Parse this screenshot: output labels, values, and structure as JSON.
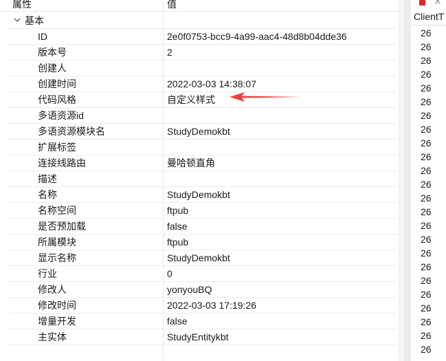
{
  "table": {
    "header_property": "属性",
    "header_value": "值",
    "group_label": "基本",
    "rows": [
      {
        "key": "ID",
        "value": "2e0f0753-bcc9-4a99-aac4-48d8b04dde36"
      },
      {
        "key": "版本号",
        "value": "2"
      },
      {
        "key": "创建人",
        "value": ""
      },
      {
        "key": "创建时间",
        "value": "2022-03-03 14:38:07"
      },
      {
        "key": "代码风格",
        "value": "自定义样式"
      },
      {
        "key": "多语资源id",
        "value": ""
      },
      {
        "key": "多语资源模块名",
        "value": "StudyDemokbt"
      },
      {
        "key": "扩展标签",
        "value": ""
      },
      {
        "key": "连接线路由",
        "value": "曼哈顿直角"
      },
      {
        "key": "描述",
        "value": ""
      },
      {
        "key": "名称",
        "value": "StudyDemokbt"
      },
      {
        "key": "名称空间",
        "value": "ftpub"
      },
      {
        "key": "是否预加载",
        "value": "false"
      },
      {
        "key": "所属模块",
        "value": "ftpub"
      },
      {
        "key": "显示名称",
        "value": "StudyDemokbt"
      },
      {
        "key": "行业",
        "value": "0"
      },
      {
        "key": "修改人",
        "value": "yonyouBQ"
      },
      {
        "key": "修改时间",
        "value": "2022-03-03 17:19:26"
      },
      {
        "key": "增量开发",
        "value": "false"
      },
      {
        "key": "主实体",
        "value": "StudyEntitykbt"
      }
    ]
  },
  "side_panel": {
    "header": "ClientT",
    "items": [
      "26",
      "26",
      "26",
      "26",
      "26",
      "26",
      "26",
      "26",
      "26",
      "26",
      "26",
      "26",
      "26",
      "26",
      "26",
      "26",
      "26",
      "26",
      "26",
      "26",
      "26",
      "26",
      "26",
      "26"
    ]
  },
  "colors": {
    "annotation_arrow": "#e8413c",
    "panel_icon": "#d8252c"
  }
}
